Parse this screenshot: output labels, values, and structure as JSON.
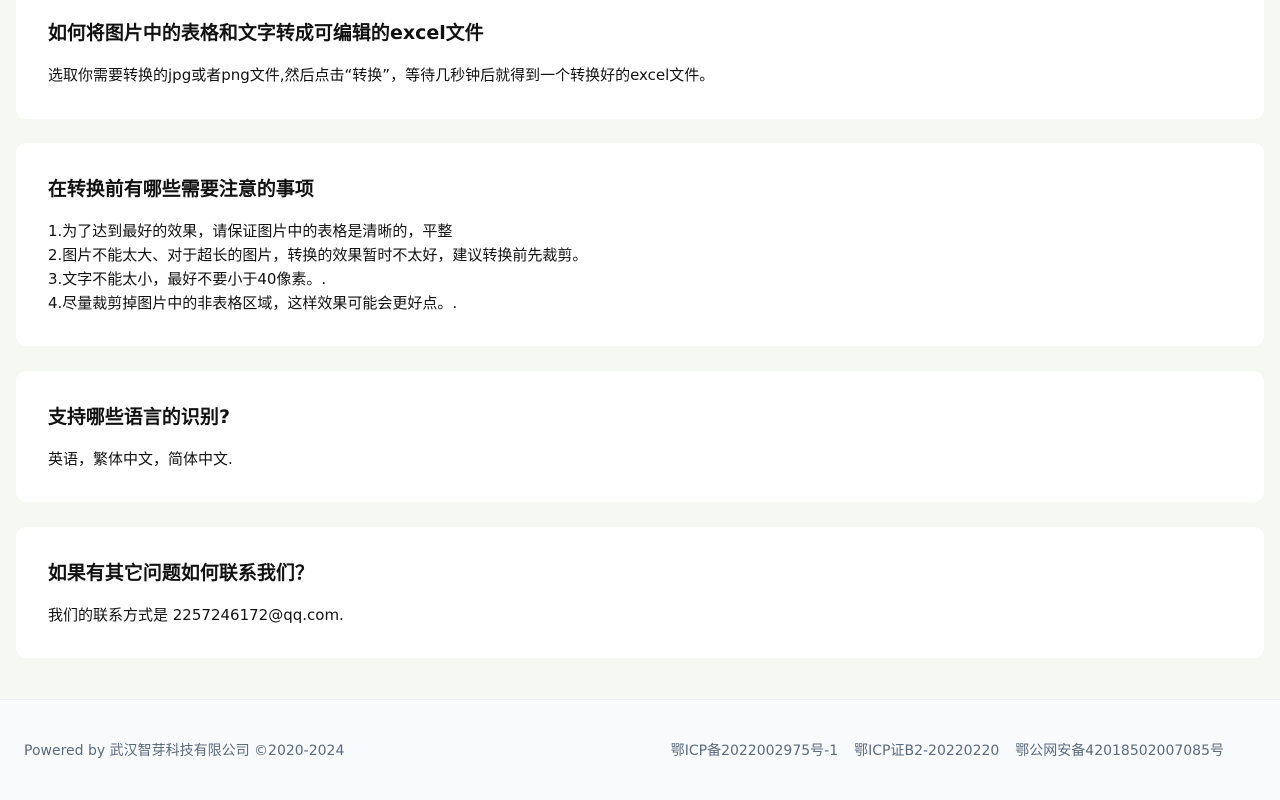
{
  "faq": [
    {
      "question": "如何将图片中的表格和文字转成可编辑的excel文件",
      "answer": "选取你需要转换的jpg或者png文件,然后点击“转换”，等待几秒钟后就得到一个转换好的excel文件。"
    },
    {
      "question": "在转换前有哪些需要注意的事项",
      "lines": [
        "1.为了达到最好的效果，请保证图片中的表格是清晰的，平整",
        "2.图片不能太大、对于超长的图片，转换的效果暂时不太好，建议转换前先裁剪。",
        "3.文字不能太小，最好不要小于40像素。.",
        "4.尽量裁剪掉图片中的非表格区域，这样效果可能会更好点。."
      ]
    },
    {
      "question": "支持哪些语言的识别?",
      "answer": "英语，繁体中文，简体中文."
    },
    {
      "question": "如果有其它问题如何联系我们？",
      "answer": "我们的联系方式是 2257246172@qq.com."
    }
  ],
  "footer": {
    "copyright": "Powered by 武汉智芽科技有限公司 ©2020-2024",
    "links": [
      "鄂ICP备2022002975号-1",
      "鄂ICP证B2-20220220",
      "鄂公网安备42018502007085号"
    ]
  }
}
